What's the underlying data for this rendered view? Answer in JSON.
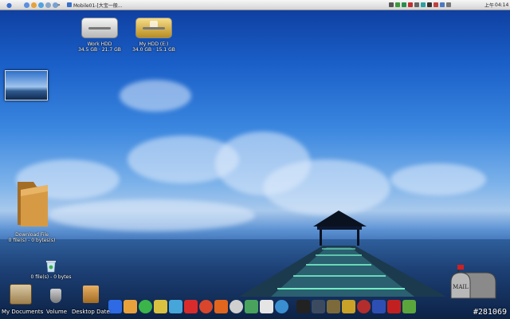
{
  "topbar": {
    "window_title": "Mobile01-[大宝一般...",
    "ime_label": "上午",
    "clock": "04:14"
  },
  "desktop_icons": {
    "work_hdd": {
      "name": "Work HDD",
      "capacity": "34.5 GB · 21.7 GB"
    },
    "my_hdd": {
      "name": "My HDD (E:)",
      "capacity": "34.0 GB · 15.1 GB"
    },
    "download_folder": {
      "name": "Download File",
      "info": "0 file(s) - 0 bytes(s)"
    },
    "trash": {
      "info": "0 file(s) - 0 bytes"
    }
  },
  "dock": {
    "my_documents": "My Documents",
    "volume": "Volume",
    "desktop_data": "Desktop Date"
  },
  "mailbox_label": "MAIL",
  "watermark": "#281069",
  "colors": {
    "sky_top": "#0d3a9a",
    "horizon": "#a9c9ec",
    "sea": "#1c3f74"
  }
}
